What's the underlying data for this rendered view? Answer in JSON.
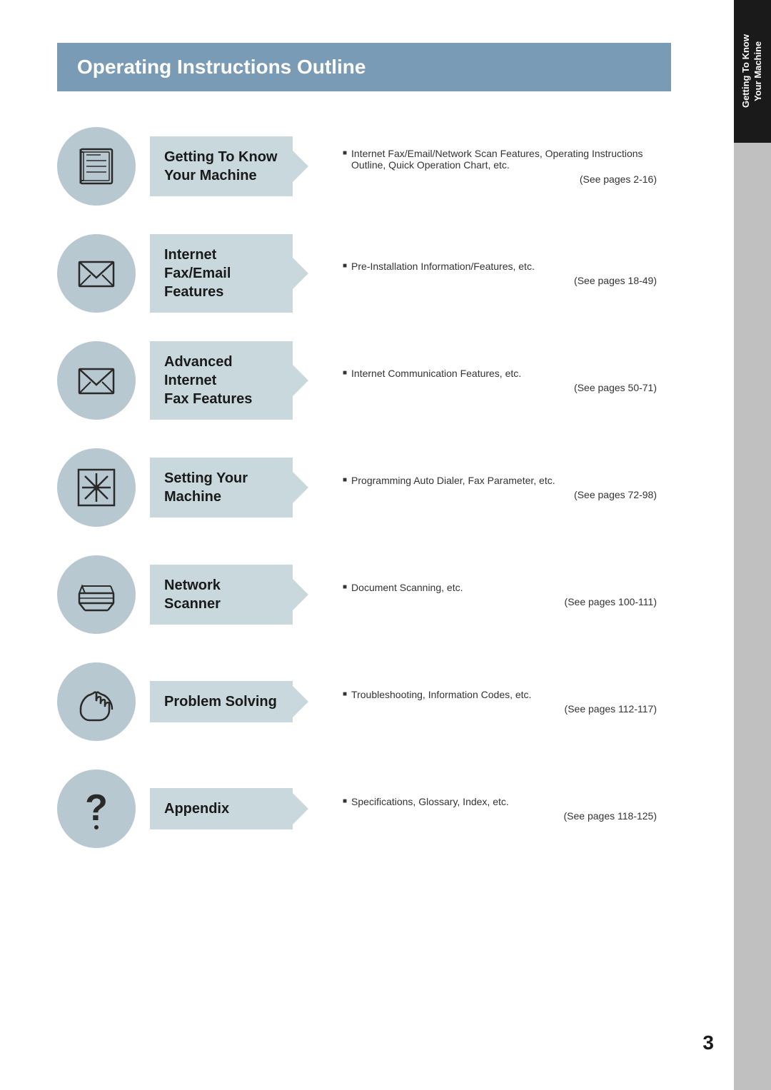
{
  "page": {
    "title": "Operating Instructions Outline",
    "page_number": "3",
    "side_tab_line1": "Getting To Know",
    "side_tab_line2": "Your Machine"
  },
  "sections": [
    {
      "id": "getting-to-know",
      "label_line1": "Getting To Know",
      "label_line2": "Your Machine",
      "icon": "book",
      "bullet": "Internet Fax/Email/Network Scan Features, Operating Instructions Outline, Quick Operation Chart, etc.",
      "see_pages": "(See pages 2-16)"
    },
    {
      "id": "internet-fax-email",
      "label_line1": "Internet Fax/Email",
      "label_line2": "Features",
      "icon": "envelope",
      "bullet": "Pre-Installation Information/Features, etc.",
      "see_pages": "(See pages 18-49)"
    },
    {
      "id": "advanced-internet-fax",
      "label_line1": "Advanced Internet",
      "label_line2": "Fax Features",
      "icon": "envelope",
      "bullet": "Internet Communication Features, etc.",
      "see_pages": "(See pages 50-71)"
    },
    {
      "id": "setting-your-machine",
      "label_line1": "Setting Your",
      "label_line2": "Machine",
      "icon": "asterisk",
      "bullet": "Programming Auto Dialer, Fax Parameter, etc.",
      "see_pages": "(See pages 72-98)"
    },
    {
      "id": "network-scanner",
      "label_line1": "Network Scanner",
      "label_line2": "",
      "icon": "scanner",
      "bullet": "Document Scanning, etc.",
      "see_pages": "(See pages 100-111)"
    },
    {
      "id": "problem-solving",
      "label_line1": "Problem Solving",
      "label_line2": "",
      "icon": "hands",
      "bullet": "Troubleshooting, Information Codes, etc.",
      "see_pages": "(See pages 112-117)"
    },
    {
      "id": "appendix",
      "label_line1": "Appendix",
      "label_line2": "",
      "icon": "question",
      "bullet": "Specifications, Glossary, Index, etc.",
      "see_pages": "(See pages 118-125)"
    }
  ]
}
